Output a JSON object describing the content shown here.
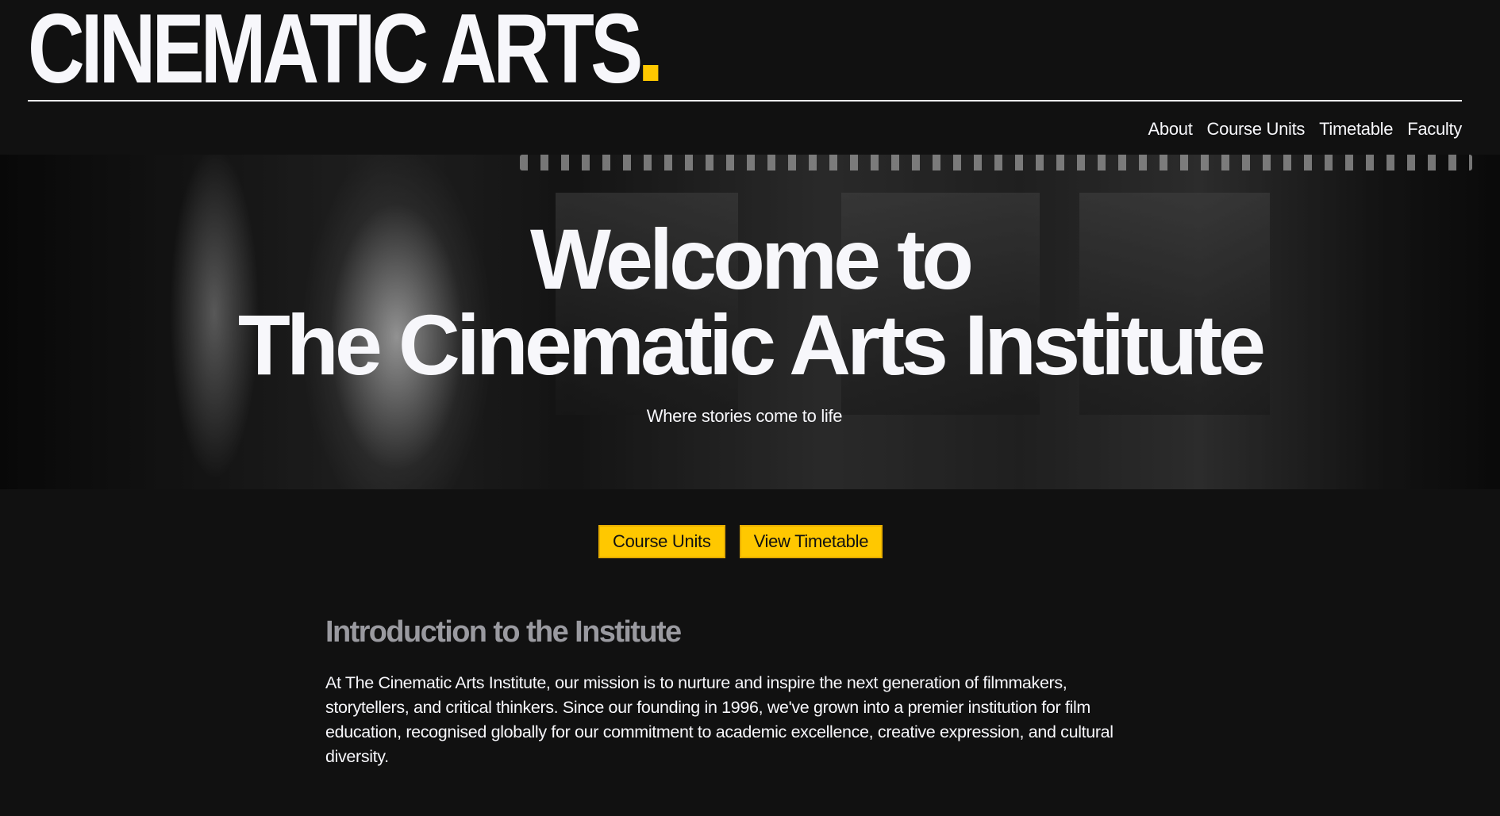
{
  "header": {
    "logo_text": "CINEMATIC ARTS",
    "nav": [
      {
        "label": "About"
      },
      {
        "label": "Course Units"
      },
      {
        "label": "Timetable"
      },
      {
        "label": "Faculty"
      }
    ]
  },
  "hero": {
    "title_line1": "Welcome to",
    "title_line2": "The Cinematic Arts Institute",
    "subtitle": "Where stories come to life"
  },
  "cta": {
    "primary_label": "Course Units",
    "secondary_label": "View Timetable"
  },
  "intro": {
    "heading": "Introduction to the Institute",
    "body": "At The Cinematic Arts Institute, our mission is to nurture and inspire the next generation of filmmakers, storytellers, and critical thinkers. Since our founding in 1996, we've grown into a premier institution for film education, recognised globally for our commitment to academic excellence, creative expression, and cultural diversity."
  },
  "colors": {
    "background": "#111111",
    "text": "#f7f7fb",
    "accent": "#ffc800",
    "heading_muted": "#9a9aa0"
  }
}
